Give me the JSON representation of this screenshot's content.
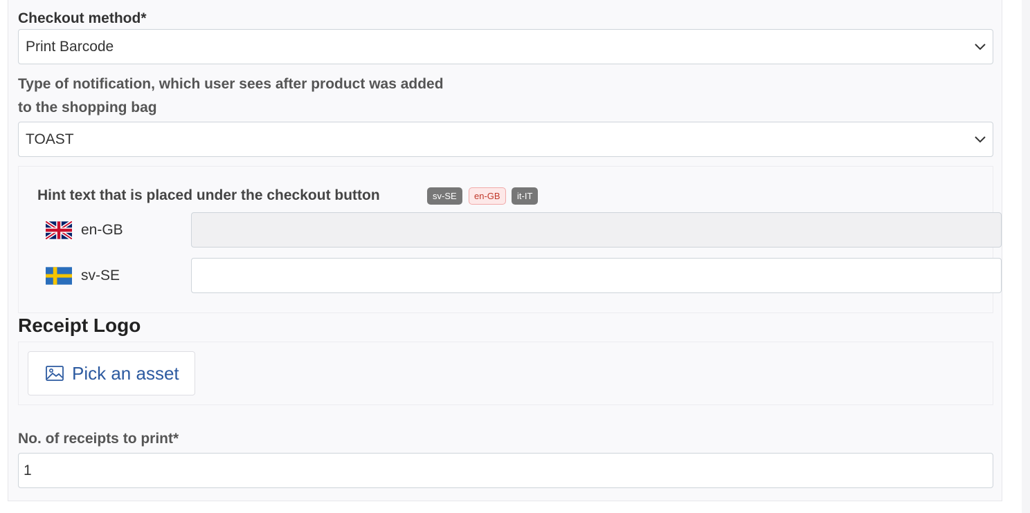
{
  "checkout_method": {
    "label": "Checkout method*",
    "value": "Print Barcode"
  },
  "notification_type": {
    "label_line1": "Type of notification, which user sees after product was added",
    "label_line2": "to the shopping bag",
    "value": "TOAST"
  },
  "hint_text": {
    "title": "Hint text that is placed under the checkout button",
    "badges": [
      "sv-SE",
      "en-GB",
      "it-IT"
    ],
    "languages": [
      {
        "code": "en-GB",
        "value": "",
        "flag": "uk-flag-icon"
      },
      {
        "code": "sv-SE",
        "value": "",
        "flag": "sweden-flag-icon"
      }
    ]
  },
  "receipt_logo": {
    "title": "Receipt Logo",
    "button_label": "Pick an asset",
    "icon": "image-icon"
  },
  "receipts_to_print": {
    "label": "No. of receipts to print*",
    "value": "1"
  },
  "colors": {
    "link_blue": "#2c5aa0",
    "badge_gray": "#777777",
    "badge_pink_text": "#c0392b",
    "badge_pink_bg": "#fde8e8"
  }
}
